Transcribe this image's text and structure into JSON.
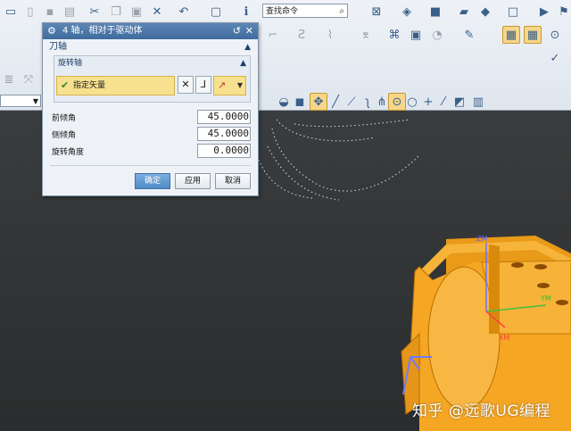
{
  "toolbar": {
    "command_search_placeholder": "查找命令",
    "icons": [
      "new-icon",
      "open-icon",
      "save-icon",
      "print-icon",
      "cut-icon",
      "copy-icon",
      "paste-icon",
      "delete-icon",
      "undo-icon",
      "window-icon",
      "info-icon",
      "search-icon",
      "select-icon",
      "render-icon",
      "cube-icon",
      "folder-icon",
      "shape-icon",
      "box-icon",
      "play-icon",
      "flag-icon"
    ]
  },
  "dialog": {
    "title": "4 轴，相对于驱动体",
    "group_title": "刀轴",
    "subgroup_title": "旋转轴",
    "vector_label": "指定矢量",
    "fields": [
      {
        "label": "前倾角",
        "value": "45.0000"
      },
      {
        "label": "侧倾角",
        "value": "45.0000"
      },
      {
        "label": "旋转角度",
        "value": "0.0000"
      }
    ],
    "buttons": {
      "ok": "确定",
      "apply": "应用",
      "cancel": "取消"
    }
  },
  "viewport": {
    "axis_labels": {
      "z": "ZM",
      "y": "YM",
      "x": "XM"
    },
    "part_color": "#f5a623"
  },
  "watermark": "知乎 @远歌UG编程"
}
